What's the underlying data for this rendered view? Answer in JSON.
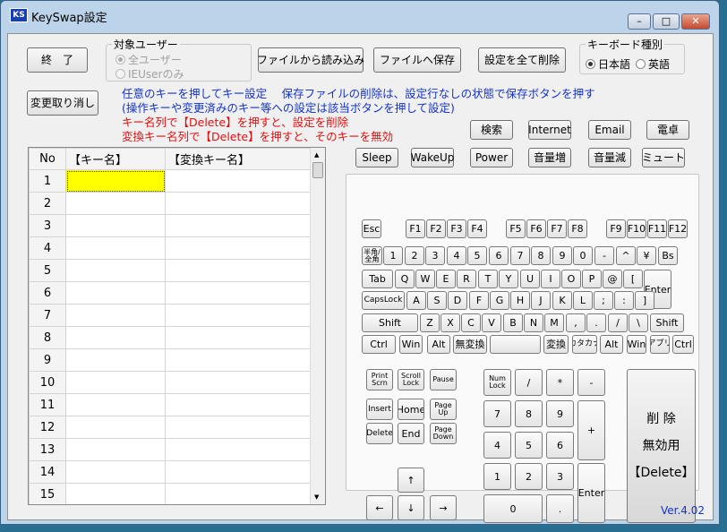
{
  "window": {
    "title": "KeySwap設定",
    "minimize": "–",
    "maximize": "□",
    "close": "✕"
  },
  "buttons": {
    "exit": "終　了",
    "load_file": "ファイルから読み込み",
    "save_file": "ファイルへ保存",
    "delete_all": "設定を全て削除",
    "undo": "変更取り消し"
  },
  "target_user": {
    "legend": "対象ユーザー",
    "all_users": "全ユーザー",
    "ie_user": "IEUserのみ"
  },
  "keyboard_type": {
    "legend": "キーボード種別",
    "japanese": "日本語",
    "english": "英語"
  },
  "info": {
    "line1": "任意のキーを押してキー設定　 保存ファイルの削除は、設定行なしの状態で保存ボタンを押す",
    "line2": "(操作キーや変更済みのキー等への設定は該当ボタンを押して設定)",
    "line3": "キー名列で【Delete】を押すと、設定を削除",
    "line4": "変換キー名列で【Delete】を押すと、そのキーを無効"
  },
  "grid": {
    "columns": [
      "No",
      "【キー名】",
      "【変換キー名】"
    ],
    "rows": [
      "1",
      "2",
      "3",
      "4",
      "5",
      "6",
      "7",
      "8",
      "9",
      "10",
      "11",
      "12",
      "13",
      "14",
      "15"
    ]
  },
  "special_keys": {
    "row1": [
      "検索",
      "Internet",
      "Email",
      "電卓"
    ],
    "row2": [
      "Sleep",
      "WakeUp",
      "Power",
      "音量増",
      "音量減",
      "ミュート"
    ]
  },
  "keyboard": {
    "fn": [
      "Esc",
      "F1",
      "F2",
      "F3",
      "F4",
      "F5",
      "F6",
      "F7",
      "F8",
      "F9",
      "F10",
      "F11",
      "F12"
    ],
    "num_row": [
      "半角/全角",
      "1",
      "2",
      "3",
      "4",
      "5",
      "6",
      "7",
      "8",
      "9",
      "0",
      "-",
      "^",
      "¥",
      "Bs"
    ],
    "q_row": [
      "Tab",
      "Q",
      "W",
      "E",
      "R",
      "T",
      "Y",
      "U",
      "I",
      "O",
      "P",
      "@",
      "["
    ],
    "a_row": [
      "CapsLock",
      "A",
      "S",
      "D",
      "F",
      "G",
      "H",
      "J",
      "K",
      "L",
      ";",
      ":",
      "]"
    ],
    "enter": "Enter",
    "z_row": [
      "Shift",
      "Z",
      "X",
      "C",
      "V",
      "B",
      "N",
      "M",
      ",",
      ".",
      "/",
      "\\",
      "Shift"
    ],
    "bottom_row": [
      "Ctrl",
      "Win",
      "Alt",
      "無変換",
      "",
      "変換",
      "カタカナ",
      "Alt",
      "Win",
      "アプリ",
      "Ctrl"
    ],
    "nav_top": [
      "Print Scrn",
      "Scroll Lock",
      "Pause"
    ],
    "nav_mid": [
      "Insert",
      "Home",
      "Page Up"
    ],
    "nav_low": [
      "Delete",
      "End",
      "Page Down"
    ],
    "arrows": {
      "up": "↑",
      "left": "←",
      "down": "↓",
      "right": "→"
    },
    "numpad": {
      "numlock": "Num Lock",
      "div": "/",
      "mul": "*",
      "minus": "-",
      "n7": "7",
      "n8": "8",
      "n9": "9",
      "plus": "+",
      "n4": "4",
      "n5": "5",
      "n6": "6",
      "n1": "1",
      "n2": "2",
      "n3": "3",
      "enter": "Enter",
      "n0": "0",
      "dot": "."
    },
    "delete_panel": {
      "line1": "削 除",
      "line2": "無効用",
      "line3": "【Delete】"
    }
  },
  "version": "Ver.4.02"
}
